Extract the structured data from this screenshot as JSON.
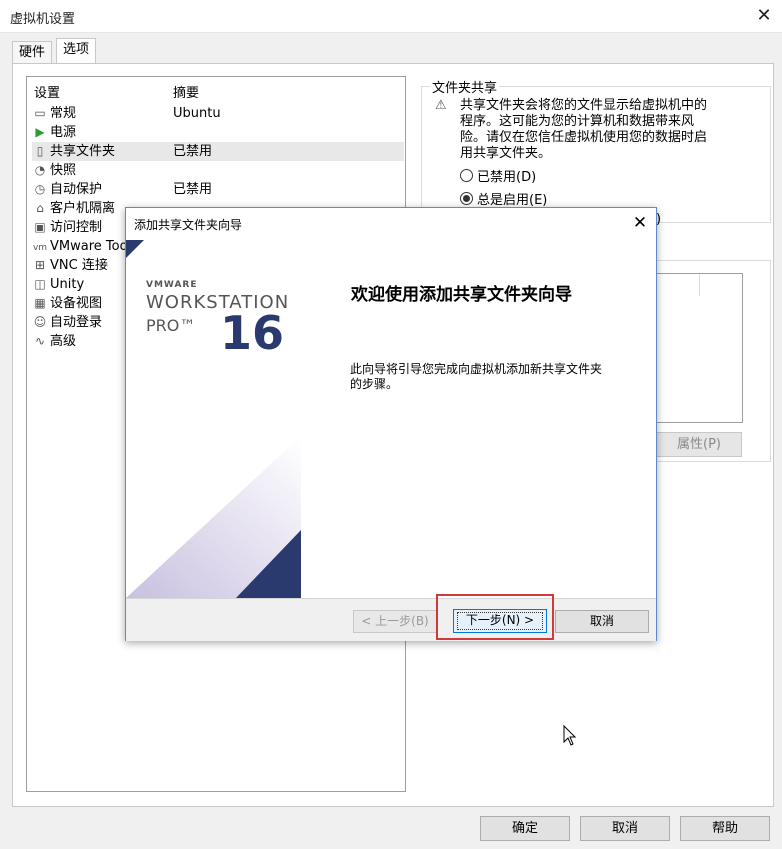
{
  "window": {
    "title": "虚拟机设置",
    "close": "✕"
  },
  "tabs": [
    {
      "label": "硬件"
    },
    {
      "label": "选项"
    }
  ],
  "list": {
    "col_setting": "设置",
    "col_summary": "摘要",
    "rows": [
      {
        "icon": "monitor-icon",
        "name": "常规",
        "summary": "Ubuntu"
      },
      {
        "icon": "power-icon",
        "name": "电源",
        "summary": ""
      },
      {
        "icon": "shared-folder-icon",
        "name": "共享文件夹",
        "summary": "已禁用"
      },
      {
        "icon": "snapshot-icon",
        "name": "快照",
        "summary": ""
      },
      {
        "icon": "autoprotect-icon",
        "name": "自动保护",
        "summary": "已禁用"
      },
      {
        "icon": "isolation-icon",
        "name": "客户机隔离",
        "summary": ""
      },
      {
        "icon": "access-control-icon",
        "name": "访问控制",
        "summary": ""
      },
      {
        "icon": "vmware-tools-icon",
        "name": "VMware Too",
        "summary": ""
      },
      {
        "icon": "vnc-icon",
        "name": "VNC 连接",
        "summary": ""
      },
      {
        "icon": "unity-icon",
        "name": "Unity",
        "summary": ""
      },
      {
        "icon": "device-view-icon",
        "name": "设备视图",
        "summary": ""
      },
      {
        "icon": "autologin-icon",
        "name": "自动登录",
        "summary": ""
      },
      {
        "icon": "advanced-icon",
        "name": "高级",
        "summary": ""
      }
    ]
  },
  "shared": {
    "group_title": "文件夹共享",
    "warning": "共享文件夹会将您的文件显示给虚拟机中的程序。这可能为您的计算机和数据带来风险。请仅在您信任虚拟机使用您的数据时启用共享文件夹。",
    "radio_disabled": "已禁用(D)",
    "radio_always": "总是启用(E)",
    "radio_partial": ")",
    "properties_button": "属性(P)"
  },
  "buttons": {
    "ok": "确定",
    "cancel": "取消",
    "help": "帮助"
  },
  "wizard": {
    "title": "添加共享文件夹向导",
    "close": "✕",
    "brand_small": "VMWARE",
    "brand_workstation": "WORKSTATION",
    "brand_pro": "PRO™",
    "brand_version": "16",
    "heading": "欢迎使用添加共享文件夹向导",
    "description": "此向导将引导您完成向虚拟机添加新共享文件夹的步骤。",
    "back": "< 上一步(B)",
    "next": "下一步(N) >",
    "cancel": "取消"
  },
  "colors": {
    "accent": "#0078d7",
    "highlight": "#d23a3a",
    "brand_navy": "#2a3a6e"
  }
}
